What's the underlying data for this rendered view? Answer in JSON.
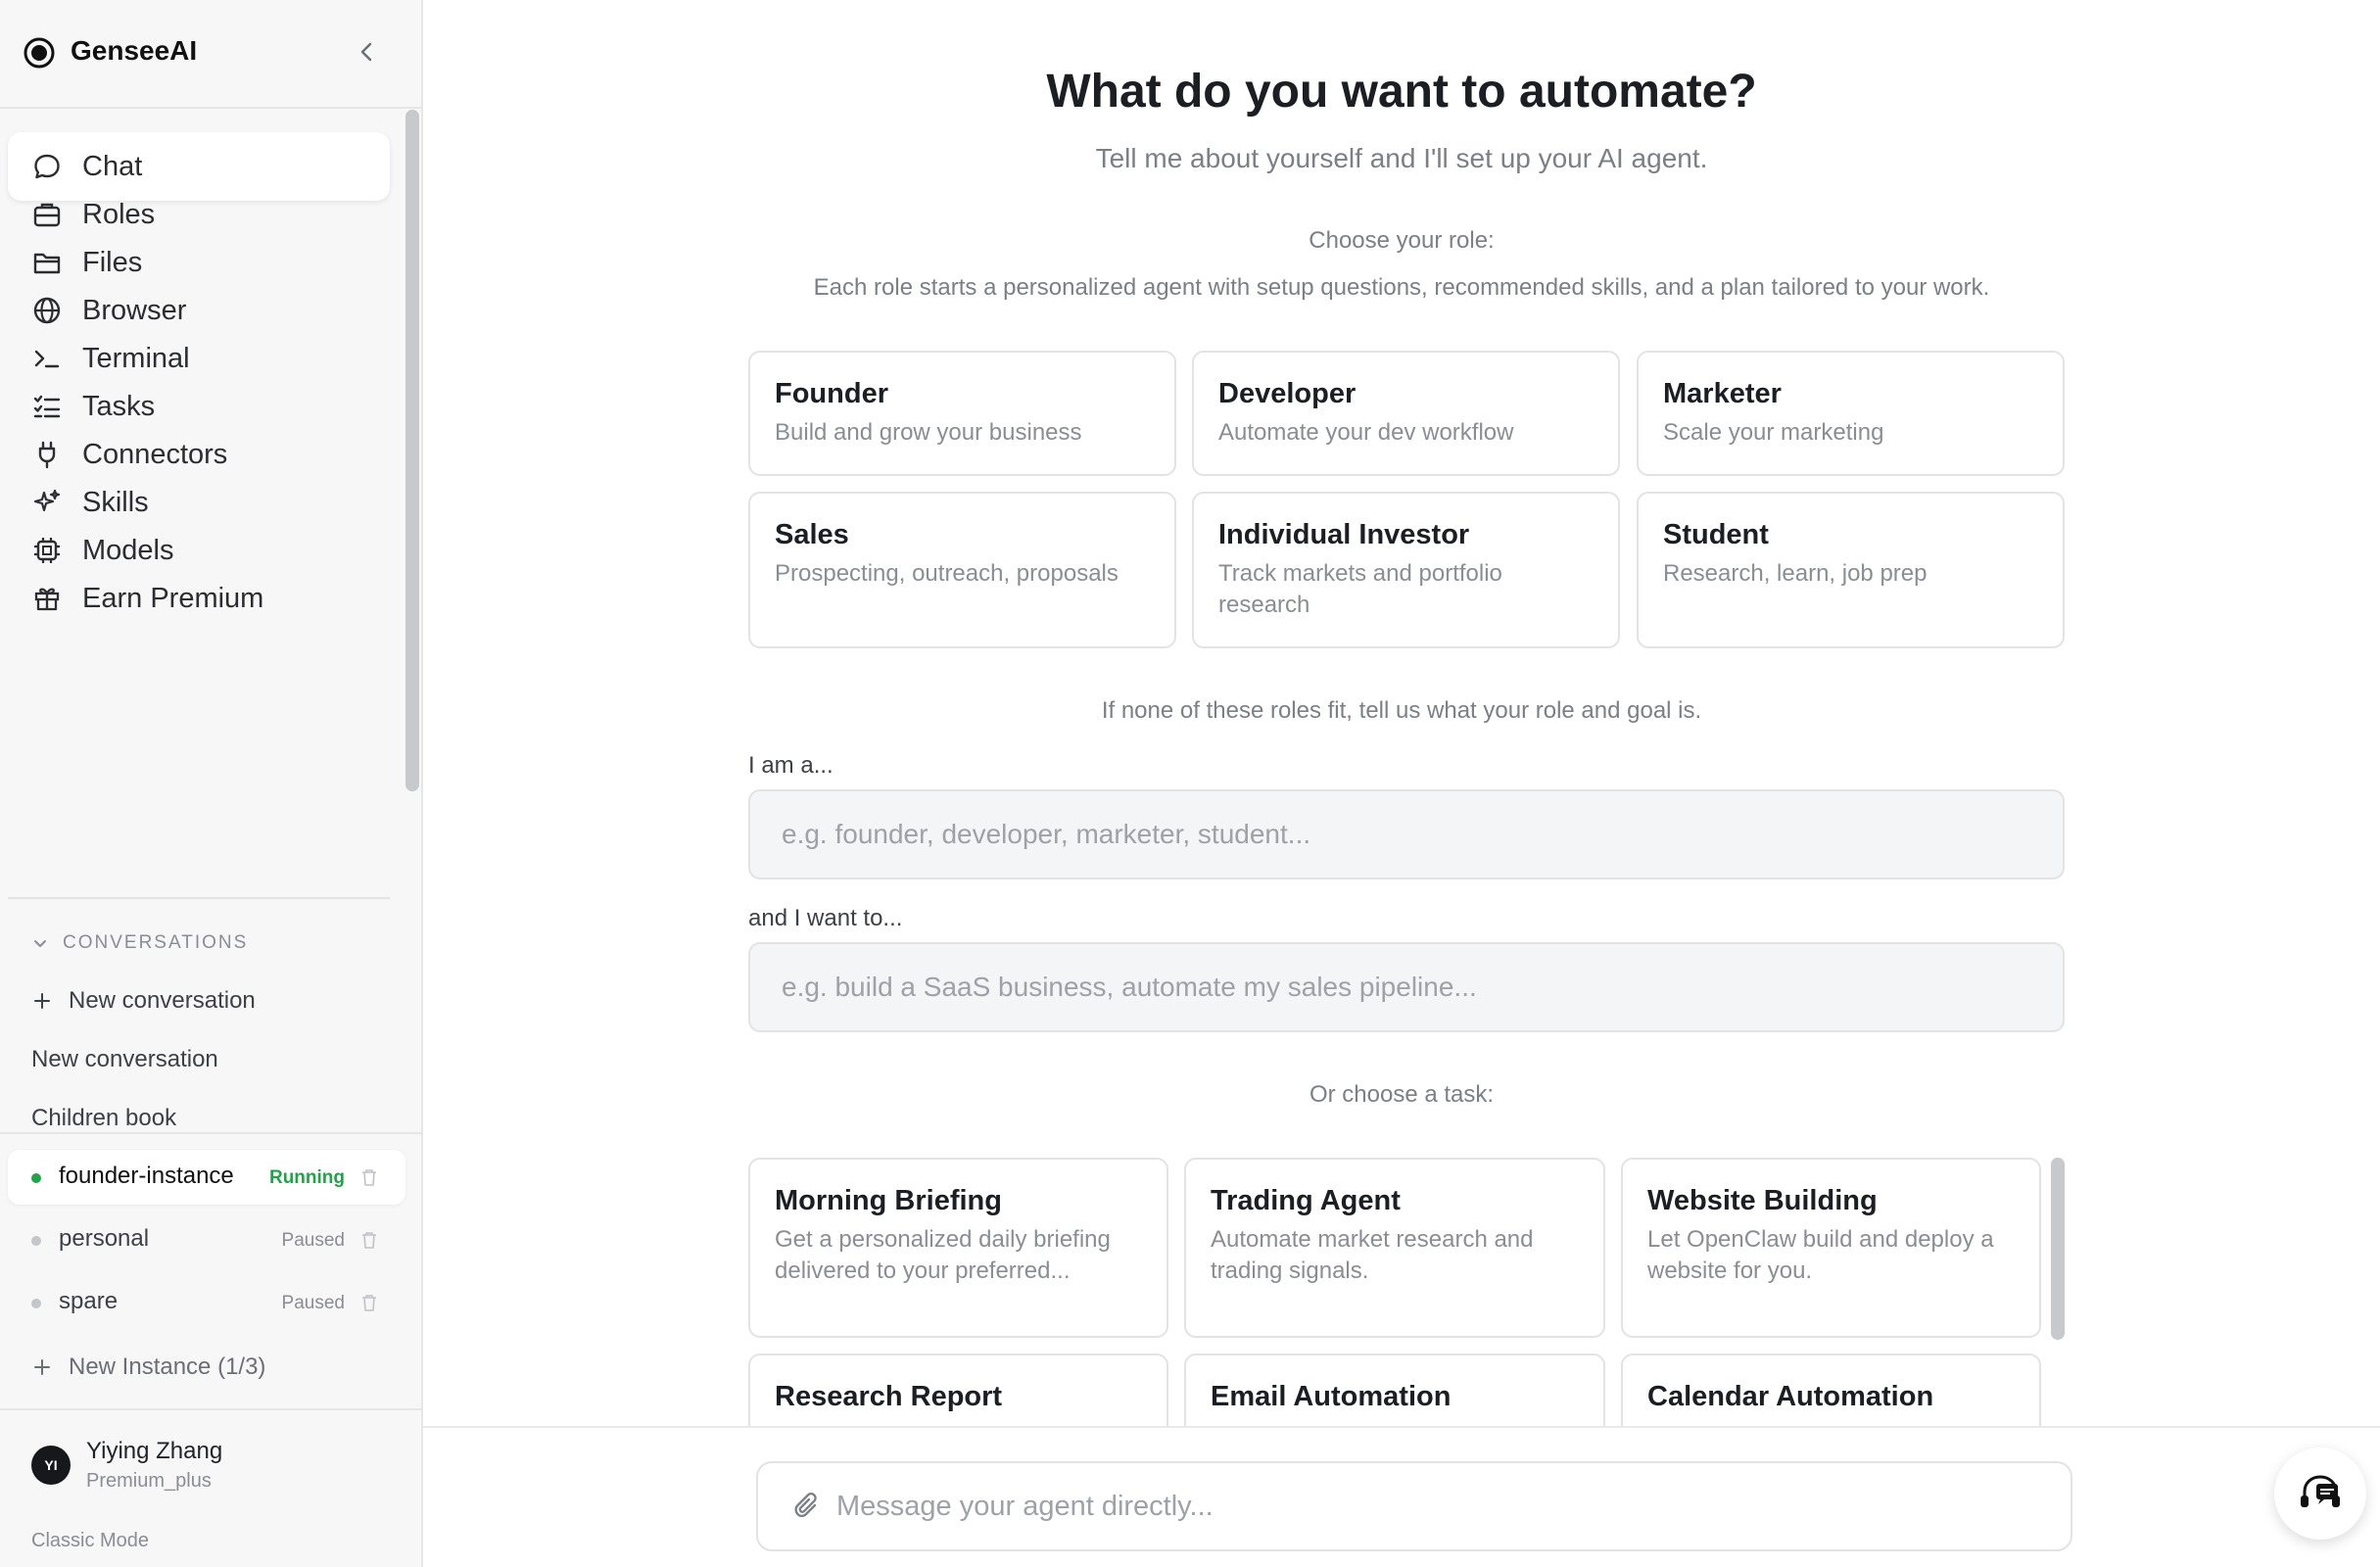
{
  "app": {
    "name": "GenseeAI"
  },
  "nav": {
    "items": [
      {
        "label": "Chat",
        "icon": "chat-bubble-icon"
      },
      {
        "label": "Roles",
        "icon": "briefcase-icon"
      },
      {
        "label": "Files",
        "icon": "folder-icon"
      },
      {
        "label": "Browser",
        "icon": "globe-icon"
      },
      {
        "label": "Terminal",
        "icon": "terminal-icon"
      },
      {
        "label": "Tasks",
        "icon": "tasks-list-icon"
      },
      {
        "label": "Connectors",
        "icon": "plug-icon"
      },
      {
        "label": "Skills",
        "icon": "sparkles-icon"
      },
      {
        "label": "Models",
        "icon": "cpu-chip-icon"
      },
      {
        "label": "Earn Premium",
        "icon": "gift-icon"
      }
    ]
  },
  "conversations": {
    "header": "CONVERSATIONS",
    "new_label": "New conversation",
    "items": [
      "New conversation",
      "Children book"
    ]
  },
  "instances": {
    "items": [
      {
        "name": "founder-instance",
        "status": "Running"
      },
      {
        "name": "personal",
        "status": "Paused"
      },
      {
        "name": "spare",
        "status": "Paused"
      }
    ],
    "new_label": "New Instance (1/3)"
  },
  "user": {
    "initials": "YI",
    "name": "Yiying Zhang",
    "plan": "Premium_plus",
    "mode": "Classic Mode"
  },
  "main": {
    "title": "What do you want to automate?",
    "subtitle": "Tell me about yourself and I'll set up your AI agent.",
    "role_heading": "Choose your role:",
    "role_desc": "Each role starts a personalized agent with setup questions, recommended skills, and a plan tailored to your work.",
    "roles": [
      {
        "title": "Founder",
        "desc": "Build and grow your business"
      },
      {
        "title": "Developer",
        "desc": "Automate your dev workflow"
      },
      {
        "title": "Marketer",
        "desc": "Scale your marketing"
      },
      {
        "title": "Sales",
        "desc": "Prospecting, outreach, proposals"
      },
      {
        "title": "Individual Investor",
        "desc": "Track markets and portfolio research"
      },
      {
        "title": "Student",
        "desc": "Research, learn, job prep"
      }
    ],
    "nofit_text": "If none of these roles fit, tell us what your role and goal is.",
    "iam_label": "I am a...",
    "iam_placeholder": "e.g. founder, developer, marketer, student...",
    "want_label": "and I want to...",
    "want_placeholder": "e.g. build a SaaS business, automate my sales pipeline...",
    "task_heading": "Or choose a task:",
    "tasks": [
      {
        "title": "Morning Briefing",
        "desc": "Get a personalized daily briefing delivered to your preferred..."
      },
      {
        "title": "Trading Agent",
        "desc": "Automate market research and trading signals."
      },
      {
        "title": "Website Building",
        "desc": "Let OpenClaw build and deploy a website for you."
      },
      {
        "title": "Research Report",
        "desc": ""
      },
      {
        "title": "Email Automation",
        "desc": ""
      },
      {
        "title": "Calendar Automation",
        "desc": ""
      }
    ]
  },
  "composer": {
    "placeholder": "Message your agent directly..."
  },
  "colors": {
    "running": "#22a347",
    "paused_dot": "#c4c6ca",
    "brand": "#111111"
  }
}
